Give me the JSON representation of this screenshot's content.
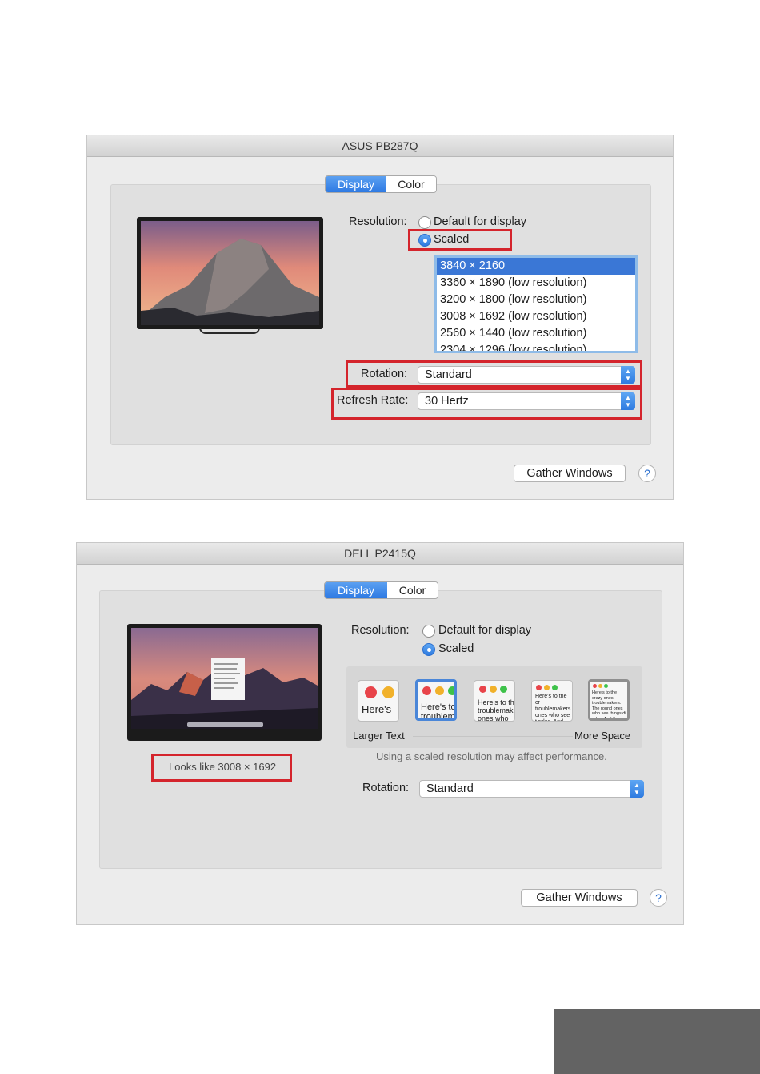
{
  "window1": {
    "title": "ASUS PB287Q",
    "tabs": [
      {
        "label": "Display",
        "active": true
      },
      {
        "label": "Color",
        "active": false
      }
    ],
    "resolution_label": "Resolution:",
    "default_option": "Default for display",
    "scaled_option": "Scaled",
    "selected_option": "Scaled",
    "resolutions": [
      "3840 × 2160",
      "3360 × 1890 (low resolution)",
      "3200 × 1800 (low resolution)",
      "3008 × 1692 (low resolution)",
      "2560 × 1440 (low resolution)",
      "2304 × 1296 (low resolution)"
    ],
    "selected_resolution": "3840 × 2160",
    "rotation_label": "Rotation:",
    "rotation_value": "Standard",
    "refresh_label": "Refresh Rate:",
    "refresh_value": "30 Hertz",
    "gather_button": "Gather Windows",
    "help_button": "?"
  },
  "window2": {
    "title": "DELL P2415Q",
    "tabs": [
      {
        "label": "Display",
        "active": true
      },
      {
        "label": "Color",
        "active": false
      }
    ],
    "resolution_label": "Resolution:",
    "default_option": "Default for display",
    "scaled_option": "Scaled",
    "selected_option": "Scaled",
    "thumbnails": [
      {
        "text": "Here's"
      },
      {
        "text": "Here's to troublem"
      },
      {
        "text": "Here's to th troublemak ones who"
      },
      {
        "text": "Here's to the cr troublemakers. ones who see t rules. And they"
      },
      {
        "text": "Here's to the crazy ones troublemakers. The round ones who see things di rules. And they have no"
      }
    ],
    "selected_thumbnail": 1,
    "larger_text_label": "Larger Text",
    "more_space_label": "More Space",
    "performance_note": "Using a scaled resolution may affect performance.",
    "looks_like": "Looks like 3008 × 1692",
    "rotation_label": "Rotation:",
    "rotation_value": "Standard",
    "gather_button": "Gather Windows",
    "help_button": "?"
  },
  "colors": {
    "highlight_red": "#d4242c",
    "accent_blue": "#3a77d6",
    "corner_block": "#636363"
  }
}
